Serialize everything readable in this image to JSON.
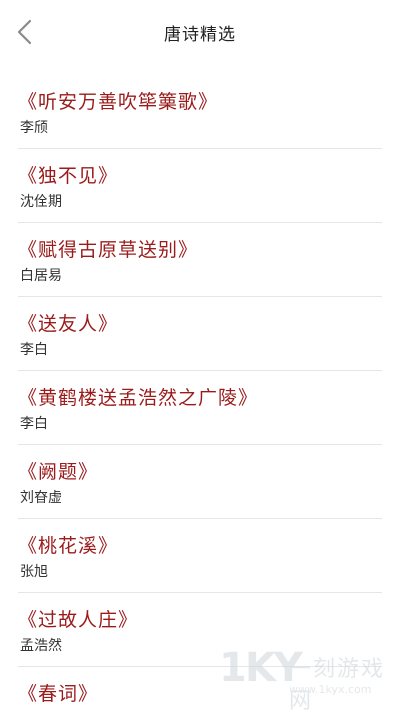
{
  "nav": {
    "title": "唐诗精选",
    "back_icon": "chevron-left-icon"
  },
  "poems": [
    {
      "title": "《听安万善吹筚篥歌》",
      "author": "李颀"
    },
    {
      "title": "《独不见》",
      "author": "沈佺期"
    },
    {
      "title": "《赋得古原草送别》",
      "author": "白居易"
    },
    {
      "title": "《送友人》",
      "author": "李白"
    },
    {
      "title": "《黄鹤楼送孟浩然之广陵》",
      "author": "李白"
    },
    {
      "title": "《阙题》",
      "author": "刘昚虚"
    },
    {
      "title": "《桃花溪》",
      "author": "张旭"
    },
    {
      "title": "《过故人庄》",
      "author": "孟浩然"
    },
    {
      "title": "《春词》",
      "author": ""
    }
  ],
  "colors": {
    "title_red": "#9b1b1b",
    "author_text": "#333333",
    "divider": "#e6e6e6",
    "background": "#ffffff"
  },
  "watermark": {
    "logo": "1KY",
    "name": "一刻游戏网",
    "url": "www.1kyx.com"
  }
}
